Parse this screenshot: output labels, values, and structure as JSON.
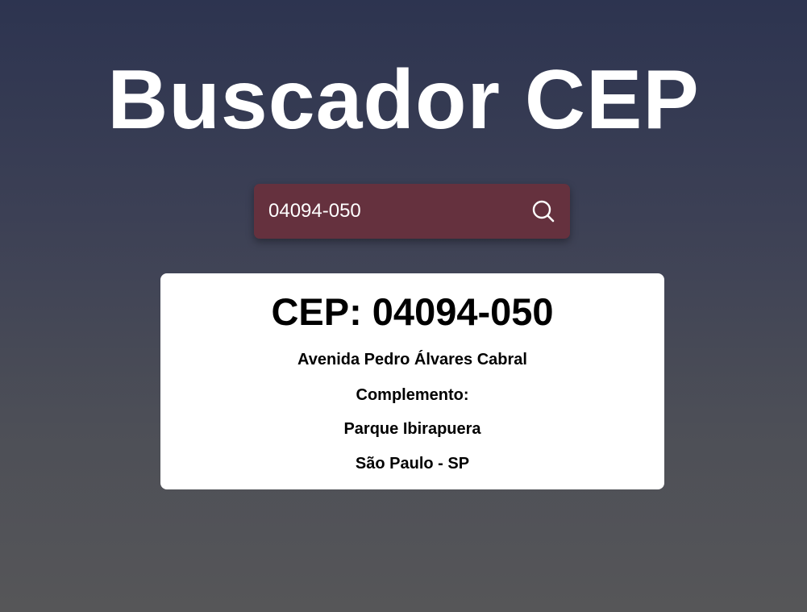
{
  "header": {
    "title": "Buscador CEP"
  },
  "search": {
    "value": "04094-050",
    "icon": "search-icon"
  },
  "result": {
    "cep": "CEP: 04094-050",
    "street": "Avenida Pedro Álvares Cabral",
    "complement": "Complemento:",
    "district": "Parque Ibirapuera",
    "city_state": "São Paulo - SP"
  },
  "colors": {
    "search_bg": "#65313e",
    "card_bg": "#ffffff",
    "text_light": "#ffffff"
  }
}
